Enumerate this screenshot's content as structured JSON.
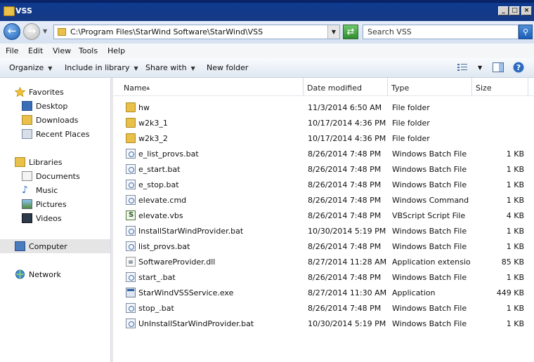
{
  "window": {
    "title": "VSS"
  },
  "nav": {
    "address": "C:\\Program Files\\StarWind Software\\StarWind\\VSS",
    "search_placeholder": "Search VSS"
  },
  "menu": [
    "File",
    "Edit",
    "View",
    "Tools",
    "Help"
  ],
  "toolbar": {
    "organize": "Organize",
    "include": "Include in library",
    "share": "Share with",
    "newfolder": "New folder"
  },
  "sidebar": {
    "favorites": "Favorites",
    "fav_items": [
      "Desktop",
      "Downloads",
      "Recent Places"
    ],
    "libraries": "Libraries",
    "lib_items": [
      "Documents",
      "Music",
      "Pictures",
      "Videos"
    ],
    "computer": "Computer",
    "network": "Network"
  },
  "columns": {
    "name": "Name",
    "date": "Date modified",
    "type": "Type",
    "size": "Size"
  },
  "files": [
    {
      "name": "hw",
      "date": "11/3/2014 6:50 AM",
      "type": "File folder",
      "size": "",
      "icon": "folder-icon"
    },
    {
      "name": "w2k3_1",
      "date": "10/17/2014 4:36 PM",
      "type": "File folder",
      "size": "",
      "icon": "folder-icon"
    },
    {
      "name": "w2k3_2",
      "date": "10/17/2014 4:36 PM",
      "type": "File folder",
      "size": "",
      "icon": "folder-icon"
    },
    {
      "name": "e_list_provs.bat",
      "date": "8/26/2014 7:48 PM",
      "type": "Windows Batch File",
      "size": "1 KB",
      "icon": "batch-file-icon"
    },
    {
      "name": "e_start.bat",
      "date": "8/26/2014 7:48 PM",
      "type": "Windows Batch File",
      "size": "1 KB",
      "icon": "batch-file-icon"
    },
    {
      "name": "e_stop.bat",
      "date": "8/26/2014 7:48 PM",
      "type": "Windows Batch File",
      "size": "1 KB",
      "icon": "batch-file-icon"
    },
    {
      "name": "elevate.cmd",
      "date": "8/26/2014 7:48 PM",
      "type": "Windows Command ...",
      "size": "1 KB",
      "icon": "command-file-icon"
    },
    {
      "name": "elevate.vbs",
      "date": "8/26/2014 7:48 PM",
      "type": "VBScript Script File",
      "size": "4 KB",
      "icon": "vbscript-file-icon"
    },
    {
      "name": "InstallStarWindProvider.bat",
      "date": "10/30/2014 5:19 PM",
      "type": "Windows Batch File",
      "size": "1 KB",
      "icon": "batch-file-icon"
    },
    {
      "name": "list_provs.bat",
      "date": "8/26/2014 7:48 PM",
      "type": "Windows Batch File",
      "size": "1 KB",
      "icon": "batch-file-icon"
    },
    {
      "name": "SoftwareProvider.dll",
      "date": "8/27/2014 11:28 AM",
      "type": "Application extension",
      "size": "85 KB",
      "icon": "dll-file-icon"
    },
    {
      "name": "start_.bat",
      "date": "8/26/2014 7:48 PM",
      "type": "Windows Batch File",
      "size": "1 KB",
      "icon": "batch-file-icon"
    },
    {
      "name": "StarWindVSSService.exe",
      "date": "8/27/2014 11:30 AM",
      "type": "Application",
      "size": "449 KB",
      "icon": "exe-file-icon"
    },
    {
      "name": "stop_.bat",
      "date": "8/26/2014 7:48 PM",
      "type": "Windows Batch File",
      "size": "1 KB",
      "icon": "batch-file-icon"
    },
    {
      "name": "UnInstallStarWindProvider.bat",
      "date": "10/30/2014 5:19 PM",
      "type": "Windows Batch File",
      "size": "1 KB",
      "icon": "batch-file-icon"
    }
  ]
}
